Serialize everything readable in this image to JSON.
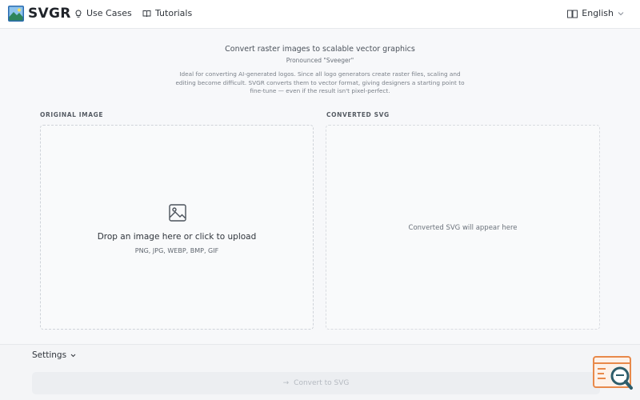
{
  "header": {
    "brand": "SVGR",
    "nav": [
      {
        "label": "Use Cases",
        "icon": "lightbulb-icon"
      },
      {
        "label": "Tutorials",
        "icon": "book-icon"
      }
    ],
    "language": {
      "label": "English",
      "icon": "book-icon"
    }
  },
  "intro": {
    "subtitle": "Convert raster images to scalable vector graphics",
    "pronounced": "Pronounced \"Sveeger\"",
    "description": "Ideal for converting AI-generated logos. Since all logo generators create raster files, scaling and editing become difficult. SVGR converts them to vector format, giving designers a starting point to fine-tune — even if the result isn't pixel-perfect."
  },
  "original": {
    "label": "ORIGINAL IMAGE",
    "drop_text": "Drop an image here or click to upload",
    "formats": "PNG, JPG, WEBP, BMP, GIF"
  },
  "converted": {
    "label": "CONVERTED SVG",
    "placeholder": "Converted SVG will appear here"
  },
  "settings": {
    "label": "Settings"
  },
  "convert_button": {
    "label": "Convert to SVG",
    "enabled": false
  },
  "colors": {
    "accent": "#e8894a",
    "brand_text": "#1f2329",
    "background": "#f7f8fa"
  }
}
